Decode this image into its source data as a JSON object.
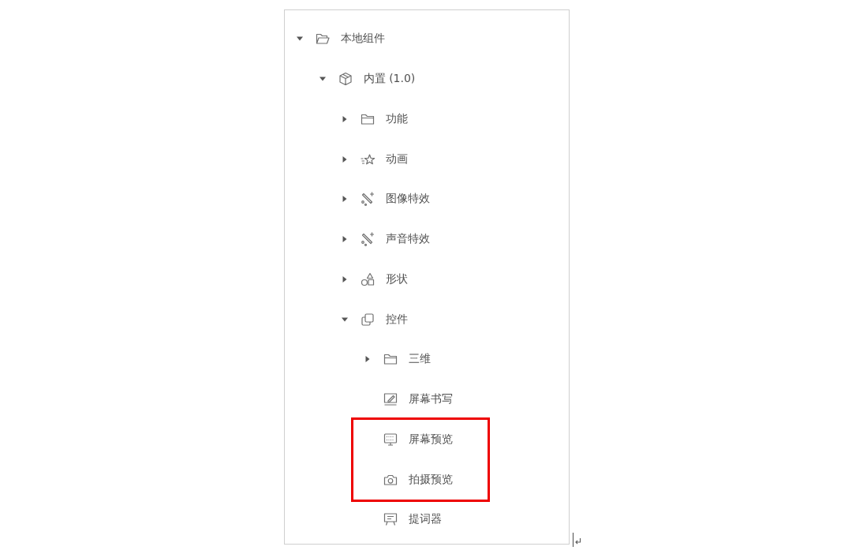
{
  "tree": [
    {
      "label": "本地组件",
      "kind": "folder",
      "expanded": true,
      "highlighted": false,
      "children": [
        {
          "label": "内置 (1.0)",
          "kind": "package",
          "expanded": true,
          "highlighted": false,
          "children": [
            {
              "label": "功能",
              "kind": "folder",
              "expanded": false,
              "highlighted": false
            },
            {
              "label": "动画",
              "kind": "animation",
              "expanded": false,
              "highlighted": false
            },
            {
              "label": "图像特效",
              "kind": "effect",
              "expanded": false,
              "highlighted": false
            },
            {
              "label": "声音特效",
              "kind": "effect",
              "expanded": false,
              "highlighted": false
            },
            {
              "label": "形状",
              "kind": "shape",
              "expanded": false,
              "highlighted": false
            },
            {
              "label": "控件",
              "kind": "controls",
              "expanded": true,
              "highlighted": false,
              "children": [
                {
                  "label": "三维",
                  "kind": "folder",
                  "expanded": false,
                  "highlighted": false
                },
                {
                  "label": "屏幕书写",
                  "kind": "writing",
                  "highlighted": false
                },
                {
                  "label": "屏幕预览",
                  "kind": "preview",
                  "highlighted": true
                },
                {
                  "label": "拍摄预览",
                  "kind": "camera",
                  "highlighted": true
                },
                {
                  "label": "提词器",
                  "kind": "prompter",
                  "highlighted": false
                }
              ]
            }
          ]
        }
      ]
    }
  ]
}
